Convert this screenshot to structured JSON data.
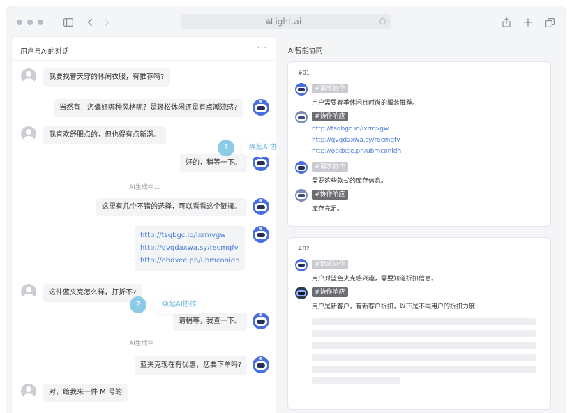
{
  "browser": {
    "url": "Light.ai"
  },
  "chat_panel": {
    "title": "用户与AI的对话",
    "more_label": "···",
    "messages": [
      {
        "role": "user",
        "text": "我要找春天穿的休闲衣服，有推荐吗?"
      },
      {
        "role": "ai",
        "text": "当然有！您偏好哪种风格呢？是轻松休闲还是有点潮流感?"
      },
      {
        "role": "user",
        "text": "我喜欢舒服点的，但也得有点新潮。"
      },
      {
        "role": "ai",
        "text": "好的，稍等一下。"
      },
      {
        "role": "system",
        "text": "AI生成中..."
      },
      {
        "role": "ai",
        "text": "这里有几个不错的选择，可以看看这个链接。"
      },
      {
        "role": "ai_links",
        "links": [
          "http://tsqbgc.io/ixrmvgw",
          "http://qvqdaxwa.sy/recmqfv",
          "http://obdxee.ph/ubmconidh"
        ]
      },
      {
        "role": "user",
        "text": "这件蓝夹克怎么样，打折不?"
      },
      {
        "role": "ai",
        "text": "请稍等，我查一下。"
      },
      {
        "role": "system",
        "text": "AI生成中..."
      },
      {
        "role": "ai",
        "text": "蓝夹克现在有优惠，您要下单吗?"
      },
      {
        "role": "user",
        "text": "对，给我来一件 M 号的"
      }
    ],
    "markers": [
      {
        "number": "1",
        "label": "唤起AI协作"
      },
      {
        "number": "2",
        "label": "唤起AI协作"
      }
    ]
  },
  "collab_panel": {
    "title": "AI智能协同",
    "cards": [
      {
        "id": "#01",
        "entries": [
          {
            "tag": "#请求协作",
            "kind": "request",
            "text": "用户需要春季休闲且时尚的服装推荐。"
          },
          {
            "tag": "#协作响应",
            "kind": "response",
            "links": [
              "http://tsqbgc.io/ixrmvgw",
              "http://qvqdaxwa.sy/recmqfv",
              "http://obdxee.ph/ubmconidh"
            ]
          },
          {
            "tag": "#请求协作",
            "kind": "request",
            "text": "需要这些款式的库存信息。"
          },
          {
            "tag": "#协作响应",
            "kind": "response",
            "text": "库存充足。"
          }
        ]
      },
      {
        "id": "#02",
        "entries": [
          {
            "tag": "#请求协作",
            "kind": "request",
            "text": "用户对蓝色夹克感兴趣，需要知道折扣信息。"
          },
          {
            "tag": "#协作响应",
            "kind": "response",
            "text": "用户是新客户，有新客户折扣，以下是不同用户的折扣力度"
          }
        ]
      }
    ]
  }
}
